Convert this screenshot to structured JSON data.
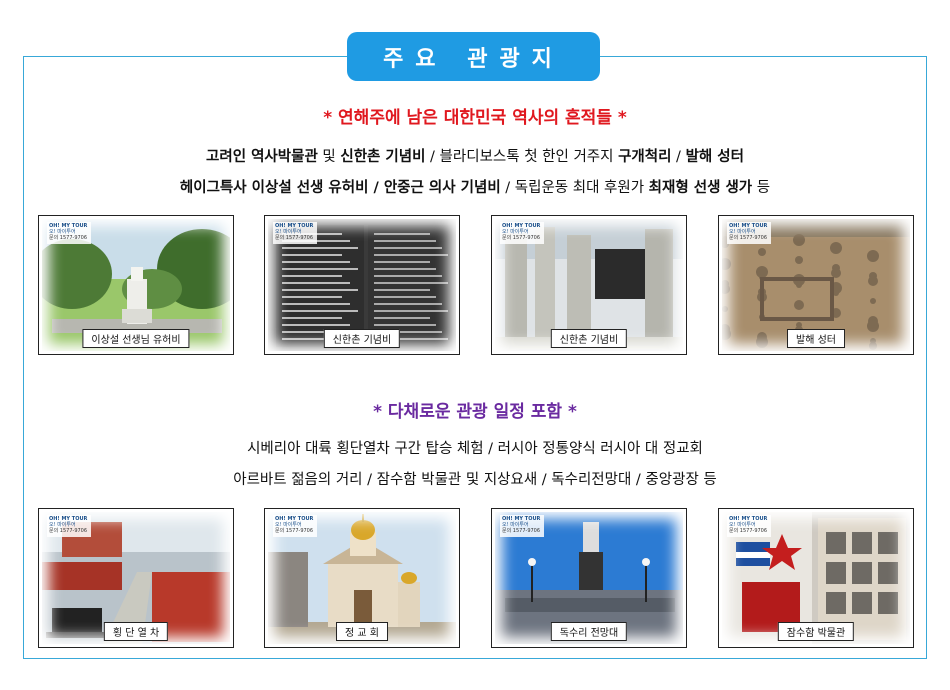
{
  "title": "주요 관광지",
  "section1": {
    "heading": "* 연해주에 남은 대한민국 역사의 흔적들 *",
    "line1": [
      {
        "t": "고려인 역사박물관",
        "b": true
      },
      {
        "t": " 및 ",
        "b": false
      },
      {
        "t": "신한촌 기념비",
        "b": true
      },
      {
        "t": " / 블라디보스톡 첫 한인 거주지 ",
        "b": false
      },
      {
        "t": "구개척리",
        "b": true
      },
      {
        "t": " / ",
        "b": false
      },
      {
        "t": "발해 성터",
        "b": true
      }
    ],
    "line2": [
      {
        "t": "헤이그특사 이상설 선생 유허비 / 안중근 의사 기념비",
        "b": true
      },
      {
        "t": " / 독립운동 최대 후원가 ",
        "b": false
      },
      {
        "t": "최재형 선생 생가",
        "b": true
      },
      {
        "t": " 등",
        "b": false
      }
    ]
  },
  "section2": {
    "heading": "* 다채로운 관광 일정 포함 *",
    "line1": "시베리아 대륙 횡단열차 구간 탑승 체험 / 러시아 정통양식 러시아 대 정교회",
    "line2": "아르바트 젊음의 거리 / 잠수함 박물관 및 지상요새 / 독수리전망대 / 중앙광장 등"
  },
  "logo": {
    "line1": "OH! MY TOUR",
    "line2": "오! 마이투어",
    "line3": "문의 1577-9706"
  },
  "photos_row1": [
    {
      "caption": "이상설 선생님 유허비",
      "scene": "monument"
    },
    {
      "caption": "신한촌 기념비",
      "scene": "plaque"
    },
    {
      "caption": "신한촌 기념비",
      "scene": "pillars"
    },
    {
      "caption": "발해 성터",
      "scene": "ruins"
    }
  ],
  "photos_row2": [
    {
      "caption": "횡 단 열 차",
      "scene": "train"
    },
    {
      "caption": "정 교 회",
      "scene": "church"
    },
    {
      "caption": "독수리 전망대",
      "scene": "lookout"
    },
    {
      "caption": "잠수함 박물관",
      "scene": "museum"
    }
  ]
}
